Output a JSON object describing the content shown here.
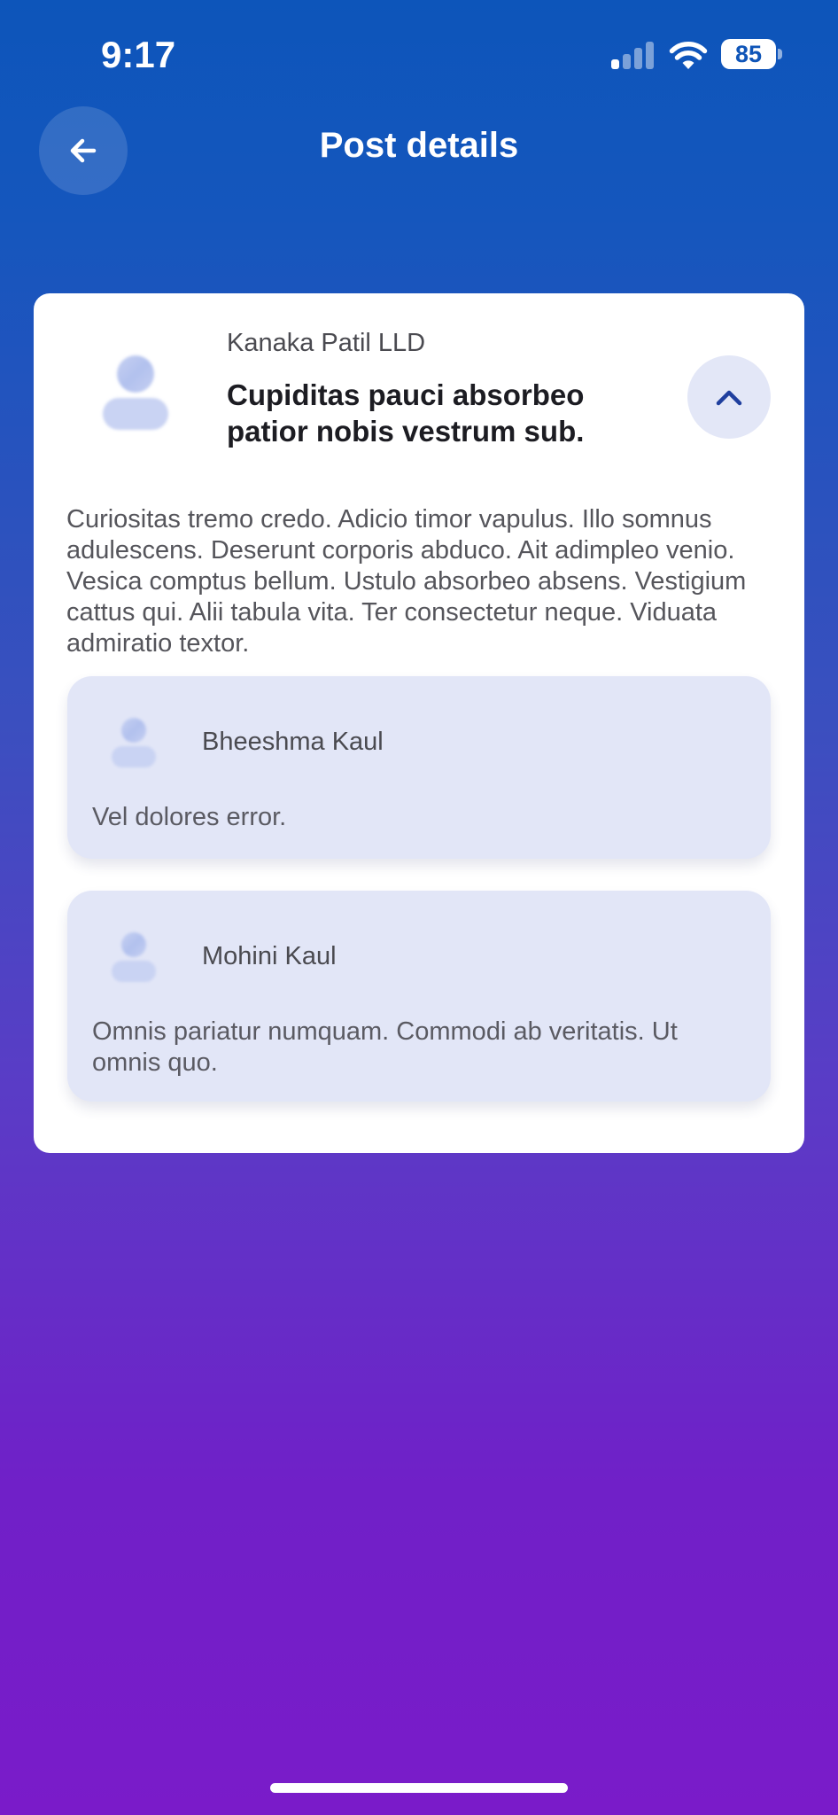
{
  "status_bar": {
    "time": "9:17",
    "battery": "85",
    "signal_bars_active": 1,
    "signal_bars_total": 4,
    "icons": [
      "cellular-signal-icon",
      "wifi-icon",
      "battery-icon"
    ]
  },
  "header": {
    "title": "Post details",
    "back_icon": "arrow-left-icon"
  },
  "post": {
    "author": "Kanaka Patil LLD",
    "title": "Cupiditas pauci absorbeo patior nobis vestrum sub.",
    "body": "Curiositas tremo credo. Adicio timor vapulus. Illo somnus adulescens. Deserunt corporis abduco. Ait adimpleo venio. Vesica comptus bellum. Ustulo absorbeo absens. Vestigium cattus qui. Alii tabula vita. Ter consectetur neque. Viduata admiratio textor.",
    "collapse_icon": "chevron-up-icon",
    "avatar_icon": "user-placeholder-icon"
  },
  "comments": [
    {
      "author": "Bheeshma Kaul",
      "text": "Vel dolores error."
    },
    {
      "author": "Mohini Kaul",
      "text": "Omnis pariatur numquam. Commodi ab veritatis. Ut omnis quo."
    }
  ],
  "colors": {
    "gradient_top": "#0d55ba",
    "gradient_bottom": "#7a1bc9",
    "card": "#ffffff",
    "comment_bg": "#e2e6f7",
    "accent": "#1f3f9e"
  }
}
